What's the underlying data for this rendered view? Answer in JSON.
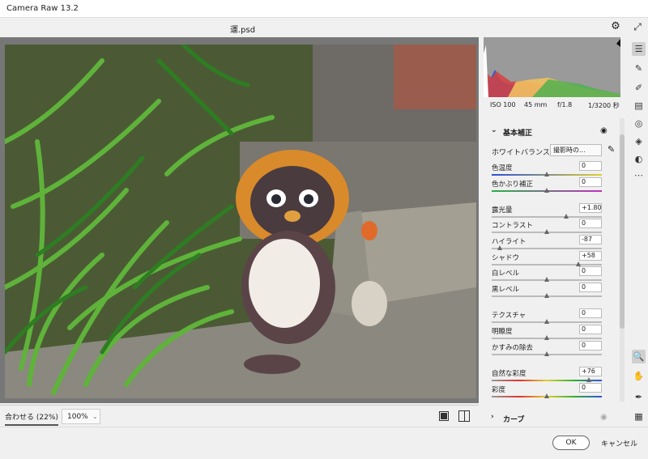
{
  "app": {
    "title": "Camera Raw 13.2",
    "document": "運.psd"
  },
  "bottom_bar": {
    "fit_label": "合わせる (22%)",
    "zoom_value": "100%"
  },
  "footer": {
    "ok_label": "OK",
    "cancel_label": "キャンセル"
  },
  "exif": {
    "iso": "ISO 100",
    "focal": "45 mm",
    "aperture": "f/1.8",
    "shutter": "1/3200 秒"
  },
  "panel": {
    "basic_title": "基本補正",
    "white_balance_label": "ホワイトバランス",
    "white_balance_value": "撮影時の...",
    "sliders": [
      {
        "label": "色温度",
        "value": "0",
        "pos": 0.5,
        "track": "temp"
      },
      {
        "label": "色かぶり補正",
        "value": "0",
        "pos": 0.5,
        "track": "tint"
      },
      {
        "label": "露光量",
        "value": "+1.80",
        "pos": 0.68,
        "track": "plain"
      },
      {
        "label": "コントラスト",
        "value": "0",
        "pos": 0.5,
        "track": "plain"
      },
      {
        "label": "ハイライト",
        "value": "-87",
        "pos": 0.07,
        "track": "plain"
      },
      {
        "label": "シャドウ",
        "value": "+58",
        "pos": 0.79,
        "track": "plain"
      },
      {
        "label": "白レベル",
        "value": "0",
        "pos": 0.5,
        "track": "plain"
      },
      {
        "label": "黒レベル",
        "value": "0",
        "pos": 0.5,
        "track": "plain"
      },
      {
        "label": "テクスチャ",
        "value": "0",
        "pos": 0.5,
        "track": "plain"
      },
      {
        "label": "明瞭度",
        "value": "0",
        "pos": 0.5,
        "track": "plain"
      },
      {
        "label": "かすみの除去",
        "value": "0",
        "pos": 0.5,
        "track": "plain"
      },
      {
        "label": "自然な彩度",
        "value": "+76",
        "pos": 0.88,
        "track": "sat"
      },
      {
        "label": "彩度",
        "value": "0",
        "pos": 0.5,
        "track": "sat"
      }
    ],
    "curve_title": "カーブ"
  },
  "colors": {
    "accent": "#1473e6",
    "panel_bg": "#f0f0f0",
    "canvas_bg": "#777777"
  }
}
